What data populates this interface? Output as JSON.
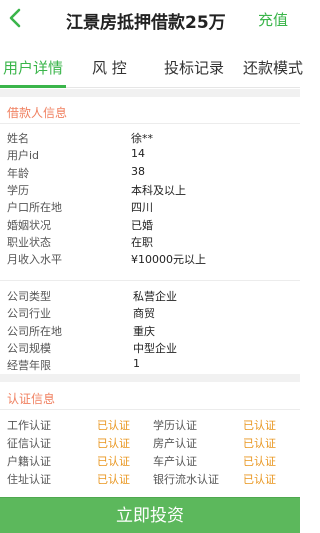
{
  "header": {
    "back_icon": "chevron-left-icon",
    "title": "江景房抵押借款25万",
    "recharge_label": "充值"
  },
  "tabs": [
    "用户详情",
    "风 控",
    "投标记录",
    "还款模式"
  ],
  "active_tab": 0,
  "borrower": {
    "section_title": "借款人信息",
    "rows": [
      {
        "label": "姓名",
        "value": "徐**"
      },
      {
        "label": "用户id",
        "value": "14"
      },
      {
        "label": "年龄",
        "value": "38"
      },
      {
        "label": "学历",
        "value": "本科及以上"
      },
      {
        "label": "户口所在地",
        "value": "四川"
      },
      {
        "label": "婚姻状况",
        "value": "已婚"
      },
      {
        "label": "职业状态",
        "value": "在职"
      },
      {
        "label": "月收入水平",
        "value": "¥10000元以上"
      }
    ]
  },
  "company": {
    "rows": [
      {
        "label": "公司类型",
        "value": "私营企业"
      },
      {
        "label": "公司行业",
        "value": "商贸"
      },
      {
        "label": "公司所在地",
        "value": "重庆"
      },
      {
        "label": "公司规模",
        "value": "中型企业"
      },
      {
        "label": "经营年限",
        "value": "1"
      }
    ]
  },
  "certification": {
    "section_title": "认证信息",
    "rows": [
      {
        "left_label": "工作认证",
        "left_status": "已认证",
        "right_label": "学历认证",
        "right_status": "已认证"
      },
      {
        "left_label": "征信认证",
        "left_status": "已认证",
        "right_label": "房产认证",
        "right_status": "已认证"
      },
      {
        "left_label": "户籍认证",
        "left_status": "已认证",
        "right_label": "车产认证",
        "right_status": "已认证"
      },
      {
        "left_label": "住址认证",
        "left_status": "已认证",
        "right_label": "银行流水认证",
        "right_status": "已认证"
      }
    ]
  },
  "footer": {
    "invest_label": "立即投资"
  },
  "colors": {
    "accent": "#3ab54a",
    "section_title": "#f08060",
    "certified": "#e9961f",
    "button": "#5cb85c"
  }
}
